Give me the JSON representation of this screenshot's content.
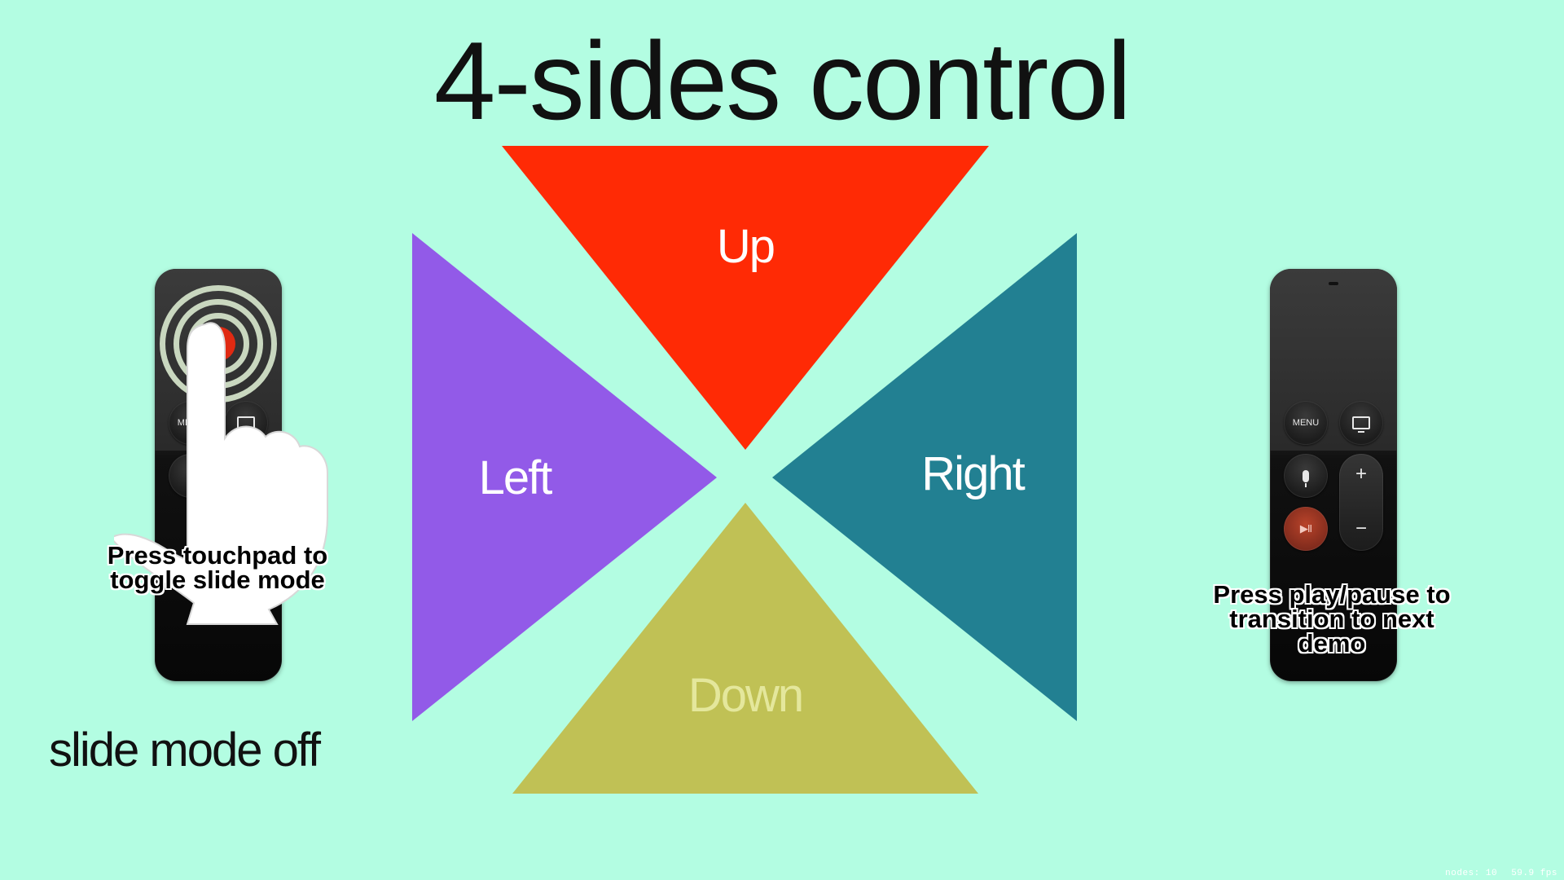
{
  "title": "4-sides control",
  "directions": {
    "up": {
      "label": "Up",
      "color": "#ff2a05"
    },
    "left": {
      "label": "Left",
      "color": "#925ae8"
    },
    "right": {
      "label": "Right",
      "color": "#228092"
    },
    "down": {
      "label": "Down",
      "color": "#c0c155"
    }
  },
  "left_remote": {
    "menu_label": "MENU",
    "hint": "Press touchpad to toggle slide mode"
  },
  "right_remote": {
    "menu_label": "MENU",
    "vol_up": "+",
    "vol_down": "−",
    "play_glyph": "▶II",
    "hint": "Press play/pause to transition to next demo"
  },
  "status": "slide mode off",
  "perf": {
    "nodes": "nodes: 10",
    "fps": "59.9 fps"
  },
  "colors": {
    "background": "#b3fde2",
    "touch_rings": "#c9d7bf",
    "touch_dot": "#e02a12"
  }
}
